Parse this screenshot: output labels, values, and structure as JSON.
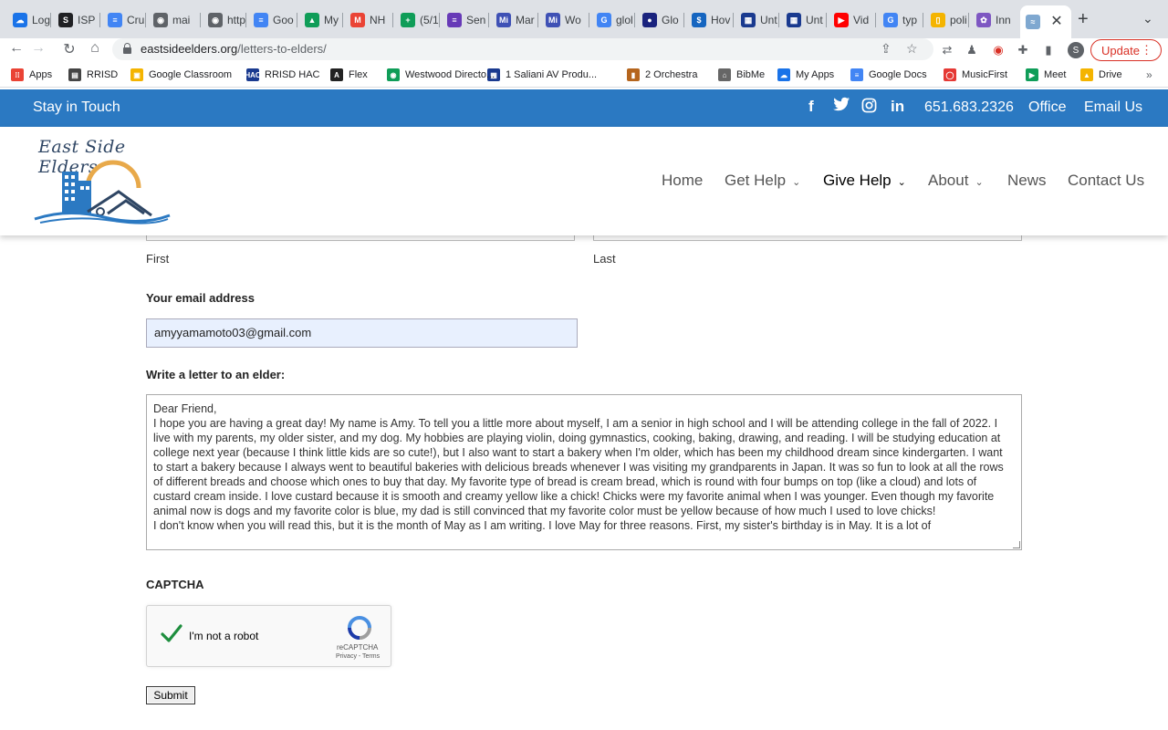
{
  "browser": {
    "tabs": [
      {
        "label": "Log",
        "color": "#1a73e8",
        "glyph": "☁"
      },
      {
        "label": "ISP",
        "color": "#202124",
        "glyph": "S"
      },
      {
        "label": "Cru",
        "color": "#4285f4",
        "glyph": "≡"
      },
      {
        "label": "mai",
        "color": "#5f6368",
        "glyph": "◉"
      },
      {
        "label": "http",
        "color": "#5f6368",
        "glyph": "◉"
      },
      {
        "label": "Goo",
        "color": "#4285f4",
        "glyph": "≡"
      },
      {
        "label": "My",
        "color": "#0f9d58",
        "glyph": "▲"
      },
      {
        "label": "NH",
        "color": "#ea4335",
        "glyph": "M"
      },
      {
        "label": "(5/1",
        "color": "#0f9d58",
        "glyph": "+"
      },
      {
        "label": "Sen",
        "color": "#673ab7",
        "glyph": "≡"
      },
      {
        "label": "Mar",
        "color": "#3f51b5",
        "glyph": "Mi"
      },
      {
        "label": "Wo",
        "color": "#3f51b5",
        "glyph": "Mi"
      },
      {
        "label": "glol",
        "color": "#4285f4",
        "glyph": "G"
      },
      {
        "label": "Glo",
        "color": "#1a237e",
        "glyph": "●"
      },
      {
        "label": "Hov",
        "color": "#1565c0",
        "glyph": "$"
      },
      {
        "label": "Unt",
        "color": "#1a3a8f",
        "glyph": "▦"
      },
      {
        "label": "Unt",
        "color": "#1a3a8f",
        "glyph": "▦"
      },
      {
        "label": "Vid",
        "color": "#ff0000",
        "glyph": "▶"
      },
      {
        "label": "typ",
        "color": "#4285f4",
        "glyph": "G"
      },
      {
        "label": "poli",
        "color": "#f4b400",
        "glyph": "▯"
      },
      {
        "label": "Inn",
        "color": "#7e57c2",
        "glyph": "✿"
      },
      {
        "label": "",
        "color": "#7fa8d0",
        "glyph": "≈"
      }
    ],
    "url_domain": "eastsideelders.org",
    "url_path": "/letters-to-elders/",
    "profile_initial": "S",
    "update_label": "Update",
    "bookmarks": [
      {
        "label": "Apps",
        "color": "#ea4335",
        "glyph": "⁞⁞"
      },
      {
        "label": "RRISD",
        "color": "#444",
        "glyph": "▤"
      },
      {
        "label": "Google Classroom",
        "color": "#f4b400",
        "glyph": "▣"
      },
      {
        "label": "RRISD HAC",
        "color": "#1a3a8f",
        "glyph": "HAC"
      },
      {
        "label": "Flex",
        "color": "#222",
        "glyph": "A"
      },
      {
        "label": "Westwood Directo...",
        "color": "#0f9d58",
        "glyph": "◉"
      },
      {
        "label": "1 Saliani AV Produ...",
        "color": "#1a3a8f",
        "glyph": "▦"
      },
      {
        "label": "2 Orchestra",
        "color": "#b5651d",
        "glyph": "▮"
      },
      {
        "label": "BibMe",
        "color": "#666",
        "glyph": "⌂"
      },
      {
        "label": "My Apps",
        "color": "#1a73e8",
        "glyph": "☁"
      },
      {
        "label": "Google Docs",
        "color": "#4285f4",
        "glyph": "≡"
      },
      {
        "label": "MusicFirst",
        "color": "#e53935",
        "glyph": "◯"
      },
      {
        "label": "Meet",
        "color": "#0f9d58",
        "glyph": "▶"
      },
      {
        "label": "Drive",
        "color": "#f4b400",
        "glyph": "▲"
      }
    ]
  },
  "site": {
    "topbar_left": "Stay in Touch",
    "phone": "651.683.2326",
    "office": "Office",
    "email_us": "Email Us",
    "logo_text": "East Side Elders",
    "nav": [
      {
        "label": "Home",
        "has_dropdown": false
      },
      {
        "label": "Get Help",
        "has_dropdown": true
      },
      {
        "label": "Give Help",
        "has_dropdown": true
      },
      {
        "label": "About",
        "has_dropdown": true
      },
      {
        "label": "News",
        "has_dropdown": false
      },
      {
        "label": "Contact Us",
        "has_dropdown": false
      }
    ]
  },
  "form": {
    "first_label": "First",
    "last_label": "Last",
    "email_label": "Your email address",
    "email_value": "amyyamamoto03@gmail.com",
    "letter_label": "Write a letter to an elder:",
    "letter_lines": [
      "Dear Friend,",
      "I hope you are having a great day! My name is Amy. To tell you a little more about myself, I am a senior in high school and I will be attending college in the fall of 2022. I live with my parents, my older sister, and my dog. My hobbies are playing violin, doing gymnastics, cooking, baking, drawing, and reading. I will be studying education at college next year (because I think little kids are so cute!), but I also want to start a bakery when I'm older, which has been my childhood dream since kindergarten. I want to start a bakery because I always went to beautiful bakeries with delicious breads whenever I was visiting my grandparents in Japan. It was so fun to look at all the rows of different breads and choose which ones to buy that day. My favorite type of bread is cream bread, which is round with four bumps on top (like a cloud) and lots of custard cream inside. I love custard because it is smooth and creamy yellow like a chick! Chicks were my favorite animal when I was younger. Even though my favorite animal now is dogs and my favorite color is blue, my dad is still convinced that my favorite color must be yellow because of how much I used to love chicks!",
      "I don't know when you will read this, but it is the month of May as I am writing. I love May for three reasons. First, my sister's birthday is in May. It is a lot of"
    ],
    "captcha_label": "CAPTCHA",
    "captcha_text": "I'm not a robot",
    "captcha_brand": "reCAPTCHA",
    "captcha_terms": "Privacy - Terms",
    "submit_label": "Submit"
  }
}
